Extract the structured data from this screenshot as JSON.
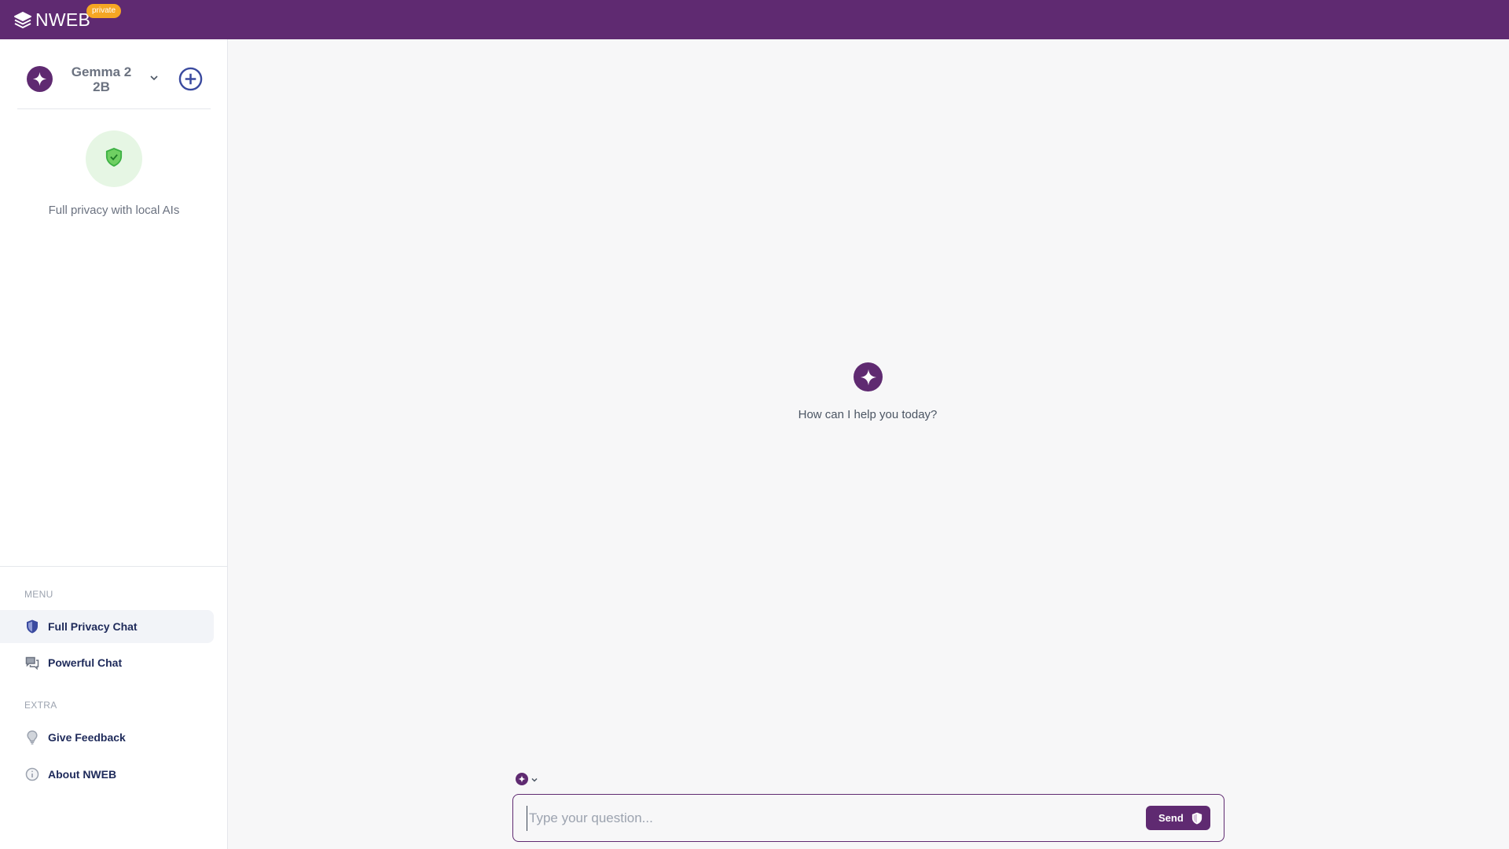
{
  "app": {
    "brand_name": "NWEB",
    "brand_badge": "private",
    "icon": "layers-icon"
  },
  "model_selector": {
    "name": "Gemma 2 2B",
    "icon": "sparkle-icon",
    "dropdown_icon": "chevron-down-icon",
    "add_icon": "plus-circle-icon"
  },
  "privacy": {
    "icon": "shield-check-icon",
    "text": "Full privacy with local AIs"
  },
  "menu": {
    "label": "MENU",
    "items": [
      {
        "label": "Full Privacy Chat",
        "icon": "shield-icon",
        "active": true
      },
      {
        "label": "Powerful Chat",
        "icon": "chat-bubbles-icon",
        "active": false
      }
    ]
  },
  "extra": {
    "label": "EXTRA",
    "items": [
      {
        "label": "Give Feedback",
        "icon": "lightbulb-icon"
      },
      {
        "label": "About NWEB",
        "icon": "info-icon"
      }
    ]
  },
  "main": {
    "greeting": "How can I help you today?",
    "hero_icon": "sparkle-icon"
  },
  "composer": {
    "placeholder": "Type your question...",
    "value": "",
    "send_label": "Send",
    "send_icon": "shield-icon"
  },
  "colors": {
    "brand": "#5f2a71",
    "badge": "#f5a623",
    "privacy_green": "#3cb043",
    "nav_text": "#1e2a5a"
  }
}
